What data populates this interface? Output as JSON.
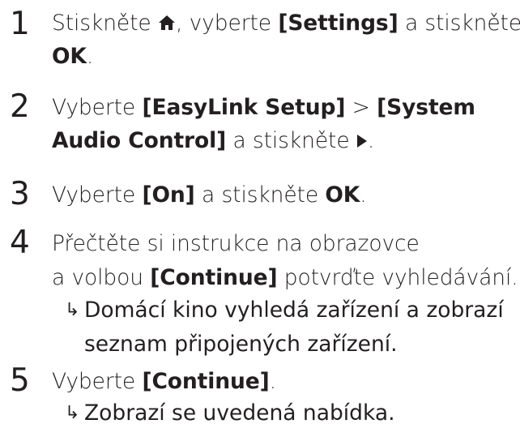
{
  "steps": [
    {
      "number": "1",
      "line1_pre": "Stiskněte ",
      "home_icon": "home-icon",
      "line1_mid": ", vyberte ",
      "line1_bold": "[Settings]",
      "line1_post": " a stiskněte",
      "line2_bold": "OK",
      "line2_post": "."
    },
    {
      "number": "2",
      "line1_pre": "Vyberte ",
      "line1_bold1": "[EasyLink Setup]",
      "line1_mid": " > ",
      "line1_bold2": "[System",
      "line2_bold": "Audio Control]",
      "line2_mid": " a stiskněte ",
      "play_icon": "play-icon",
      "line2_post": "."
    },
    {
      "number": "3",
      "line1_pre": "Vyberte ",
      "line1_bold1": "[On]",
      "line1_mid": " a stiskněte ",
      "line1_bold2": "OK",
      "line1_post": "."
    },
    {
      "number": "4",
      "line1": "Přečtěte si instrukce na obrazovce",
      "line2_pre": "a volbou ",
      "line2_bold": "[Continue]",
      "line2_post": " potvrďte vyhledávání.",
      "result_arrow": "↳",
      "result_line1": "Domácí kino vyhledá zařízení a zobrazí",
      "result_line2": "seznam připojených zařízení."
    },
    {
      "number": "5",
      "line1_pre": "Vyberte ",
      "line1_bold": "[Continue]",
      "line1_post": ".",
      "result_arrow": "↳",
      "result_line1": "Zobrazí se uvedená nabídka."
    }
  ]
}
